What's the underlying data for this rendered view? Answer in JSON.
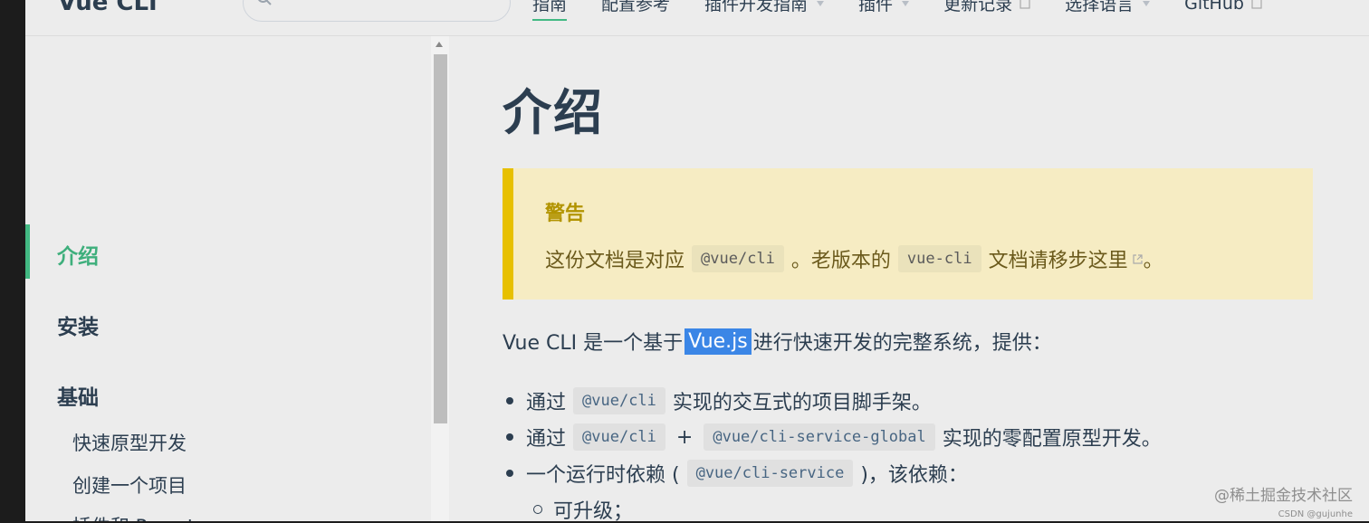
{
  "navbar": {
    "logo": "Vue CLI",
    "search_placeholder": "",
    "links": [
      {
        "label": "指南",
        "active": true
      },
      {
        "label": "配置参考"
      },
      {
        "label": "插件开发指南",
        "dropdown": true
      },
      {
        "label": "插件",
        "dropdown": true
      },
      {
        "label": "更新记录",
        "external": true
      },
      {
        "label": "选择语言",
        "dropdown": true
      },
      {
        "label": "GitHub",
        "external": true
      }
    ]
  },
  "sidebar": {
    "items": [
      {
        "label": "介绍",
        "active": true
      },
      {
        "label": "安装"
      },
      {
        "label": "基础"
      }
    ],
    "subitems": [
      {
        "label": "快速原型开发"
      },
      {
        "label": "创建一个项目"
      },
      {
        "label": "插件和 Preset"
      }
    ]
  },
  "content": {
    "title": "介绍",
    "warning": {
      "title": "警告",
      "text_1": "这份文档是对应",
      "code_1": "@vue/cli",
      "text_2": "。老版本的",
      "code_2": "vue-cli",
      "link": "文档请移步这里",
      "text_3": "。"
    },
    "intro": {
      "prefix": "Vue CLI 是一个基于",
      "highlight": "Vue.js",
      "suffix": "进行快速开发的完整系统，提供："
    },
    "list": [
      {
        "text_1": "通过",
        "code_1": "@vue/cli",
        "text_2": "实现的交互式的项目脚手架。"
      },
      {
        "text_1": "通过",
        "code_1": "@vue/cli",
        "plus": "+",
        "code_2": "@vue/cli-service-global",
        "text_2": "实现的零配置原型开发。"
      },
      {
        "text_1": "一个运行时依赖 (",
        "code_1": "@vue/cli-service",
        "text_2": ")，该依赖："
      }
    ],
    "sublist": [
      {
        "text": "可升级；"
      }
    ]
  },
  "watermark": {
    "main": "@稀土掘金技术社区",
    "sub": "CSDN @gujunhe"
  },
  "colors": {
    "accent": "#42b983",
    "warning_bg": "#f6ecc3",
    "warning_border": "#e7c000",
    "selection": "#3b86e6"
  }
}
